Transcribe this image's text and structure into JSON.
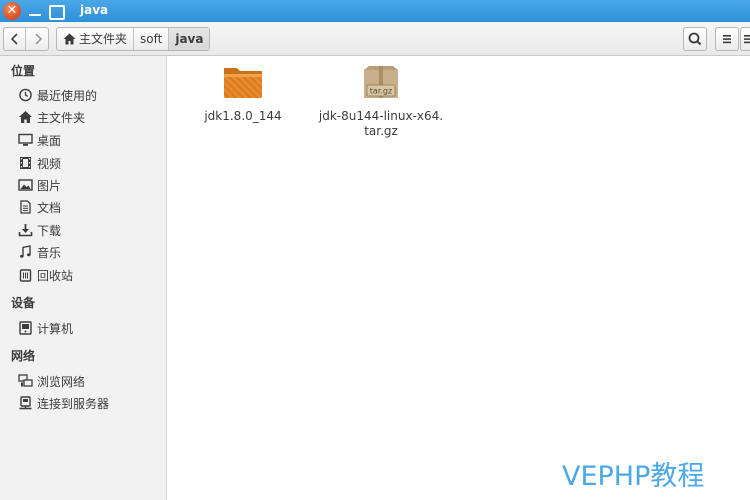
{
  "window": {
    "title": "java"
  },
  "toolbar": {
    "back_icon": "chevron-left-icon",
    "forward_icon": "chevron-right-icon",
    "breadcrumbs": [
      "主文件夹",
      "soft",
      "java"
    ],
    "search_icon": "search-icon",
    "menu_icon": "hamburger-menu-icon"
  },
  "sidebar": {
    "places_header": "位置",
    "places": [
      {
        "label": "最近使用的",
        "icon": "clock-icon"
      },
      {
        "label": "主文件夹",
        "icon": "home-icon"
      },
      {
        "label": "桌面",
        "icon": "desktop-icon"
      },
      {
        "label": "视频",
        "icon": "film-icon"
      },
      {
        "label": "图片",
        "icon": "picture-icon"
      },
      {
        "label": "文档",
        "icon": "document-icon"
      },
      {
        "label": "下载",
        "icon": "download-icon"
      },
      {
        "label": "音乐",
        "icon": "music-note-icon"
      },
      {
        "label": "回收站",
        "icon": "trash-icon"
      }
    ],
    "devices_header": "设备",
    "devices": [
      {
        "label": "计算机",
        "icon": "computer-icon"
      }
    ],
    "network_header": "网络",
    "network": [
      {
        "label": "浏览网络",
        "icon": "network-icon"
      },
      {
        "label": "连接到服务器",
        "icon": "server-icon"
      }
    ]
  },
  "files": [
    {
      "name": "jdk1.8.0_144",
      "type": "folder",
      "icon": "folder-icon"
    },
    {
      "name_line1": "jdk-8u144-linux-x64.",
      "name_line2": "tar.gz",
      "archive_label": "tar.gz",
      "type": "archive",
      "icon": "archive-icon"
    }
  ],
  "watermark": "VEPHP教程",
  "colors": {
    "titlebar": "#3a9be0",
    "folder": "#e8892e",
    "watermark": "#4aa9e6"
  }
}
